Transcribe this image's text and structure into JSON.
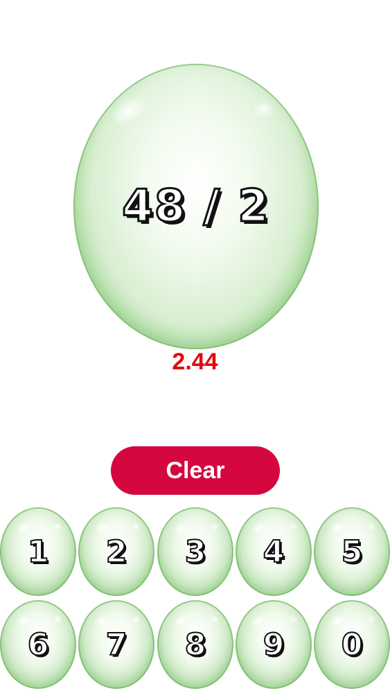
{
  "display": {
    "problem": "48 / 2",
    "answer": "2.44"
  },
  "controls": {
    "clear_label": "Clear"
  },
  "keypad": {
    "row1": [
      "1",
      "2",
      "3",
      "4",
      "5"
    ],
    "row2": [
      "6",
      "7",
      "8",
      "9",
      "0"
    ]
  },
  "colors": {
    "answer": "#e8000a",
    "clear_button": "#d4083e",
    "bubble": "#8ccd78"
  }
}
